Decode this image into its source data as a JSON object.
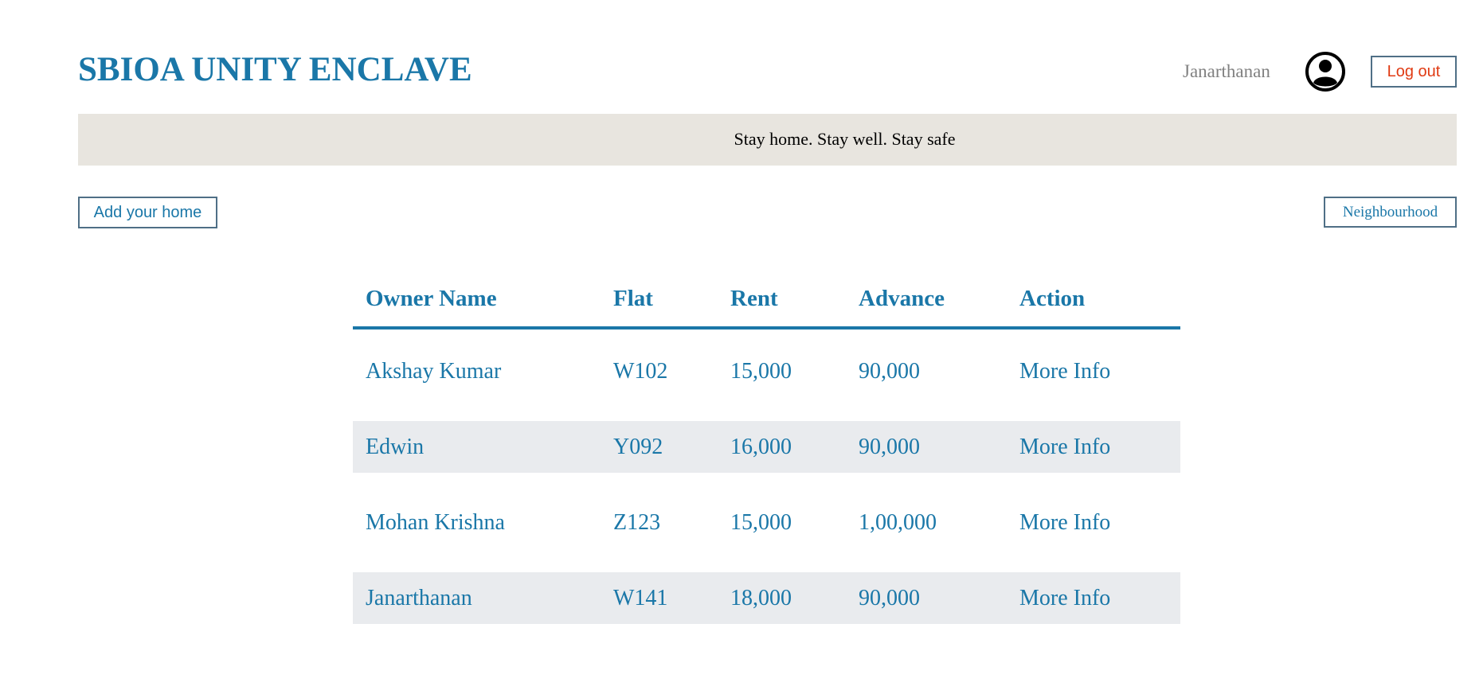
{
  "header": {
    "site_title": "SBIOA UNITY ENCLAVE",
    "user_name": "Janarthanan",
    "avatar_icon": "account-circle-icon",
    "logout_label": "Log out"
  },
  "banner": {
    "message": "Stay home. Stay well. Stay safe"
  },
  "actions": {
    "add_home_label": "Add your home",
    "neighbourhood_label": "Neighbourhood"
  },
  "colors": {
    "brand": "#1a77a8",
    "logout_text": "#e03a12",
    "banner_bg": "#e8e5df",
    "row_shade": "#e9ebee"
  },
  "table": {
    "columns": [
      "Owner Name",
      "Flat",
      "Rent",
      "Advance",
      "Action"
    ],
    "rows": [
      {
        "owner": "Akshay Kumar",
        "flat": "W102",
        "rent": "15,000",
        "advance": "90,000",
        "action": "More Info"
      },
      {
        "owner": "Edwin",
        "flat": "Y092",
        "rent": "16,000",
        "advance": "90,000",
        "action": "More Info"
      },
      {
        "owner": "Mohan Krishna",
        "flat": "Z123",
        "rent": "15,000",
        "advance": "1,00,000",
        "action": "More Info"
      },
      {
        "owner": "Janarthanan",
        "flat": "W141",
        "rent": "18,000",
        "advance": "90,000",
        "action": "More Info"
      }
    ]
  }
}
